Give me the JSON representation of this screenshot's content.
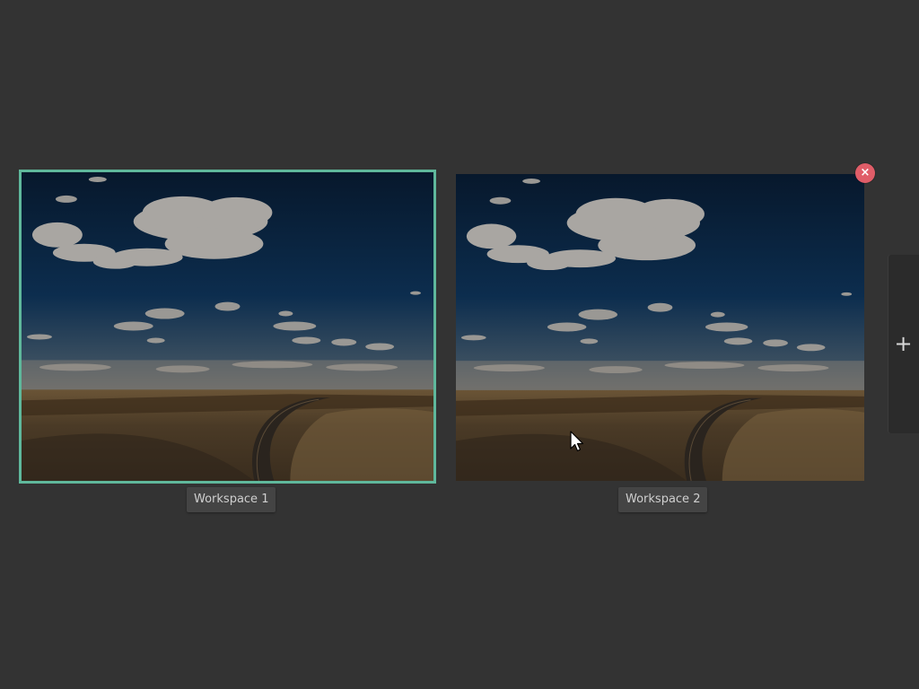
{
  "workspaces": [
    {
      "label": "Workspace 1",
      "active": true
    },
    {
      "label": "Workspace 2",
      "active": false
    }
  ],
  "controls": {
    "close_glyph": "×",
    "close_icon": "close-icon",
    "add_glyph": "+",
    "add_icon": "plus-icon"
  },
  "colors": {
    "background": "#333333",
    "active_border": "#5fb89c",
    "close_button": "#e05d68",
    "label_bg": "#444444",
    "label_text": "#cfcfcf"
  }
}
